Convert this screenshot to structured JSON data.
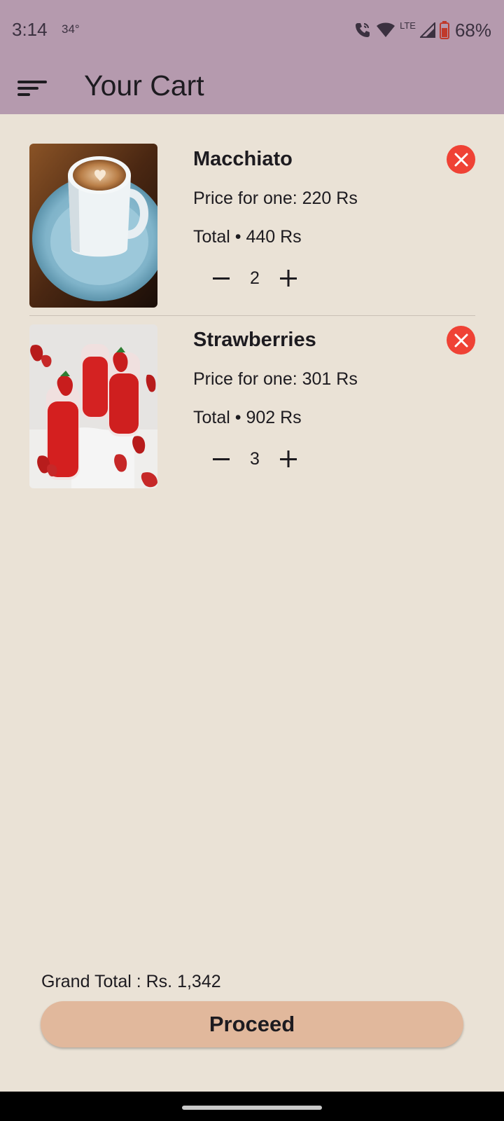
{
  "status_bar": {
    "time": "3:14",
    "temperature": "34°",
    "network": "LTE",
    "battery": "68%",
    "icons": [
      "wifi-call-icon",
      "wifi-icon",
      "signal-icon",
      "battery-icon"
    ]
  },
  "app_bar": {
    "title": "Your Cart",
    "menu_icon": "sort-menu-icon",
    "background": "#B59AAE"
  },
  "cart": {
    "items": [
      {
        "name": "Macchiato",
        "price_text": "Price for one: 220 Rs",
        "total_text": "Total • 440 Rs",
        "quantity": "2",
        "image": "macchiato-photo"
      },
      {
        "name": "Strawberries",
        "price_text": "Price for one: 301 Rs",
        "total_text": "Total • 902 Rs",
        "quantity": "3",
        "image": "strawberry-juice-photo"
      }
    ]
  },
  "footer": {
    "grand_total": "Grand Total : Rs. 1,342",
    "proceed_label": "Proceed"
  },
  "colors": {
    "background": "#EAE2D6",
    "remove_red": "#EF4235",
    "proceed_button": "#E1B89C"
  }
}
